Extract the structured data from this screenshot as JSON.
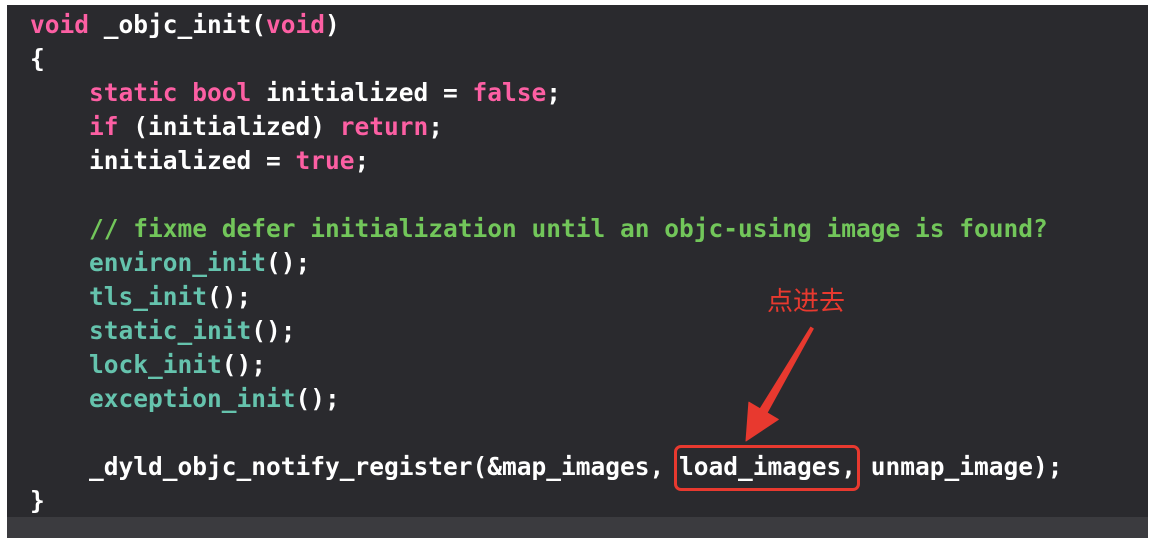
{
  "theme": {
    "page_background": "#ffffff",
    "editor_background": "#2a2a2e",
    "footer_strip": "#3b3b3f",
    "plain_text": "#ffffff",
    "keyword": "#fc5fa3",
    "comment": "#72c65a",
    "function": "#65c3ad",
    "annotation": "#e8392f"
  },
  "code": {
    "lines": [
      {
        "tokens": [
          {
            "kind": "keyword",
            "text": "void"
          },
          {
            "kind": "plain",
            "text": " _objc_init("
          },
          {
            "kind": "keyword",
            "text": "void"
          },
          {
            "kind": "plain",
            "text": ")"
          }
        ]
      },
      {
        "tokens": [
          {
            "kind": "plain",
            "text": "{"
          }
        ]
      },
      {
        "tokens": [
          {
            "kind": "keyword",
            "text": "static bool"
          },
          {
            "kind": "plain",
            "text": " initialized = "
          },
          {
            "kind": "keyword",
            "text": "false"
          },
          {
            "kind": "plain",
            "text": ";"
          }
        ]
      },
      {
        "tokens": [
          {
            "kind": "keyword",
            "text": "if"
          },
          {
            "kind": "plain",
            "text": " (initialized) "
          },
          {
            "kind": "keyword",
            "text": "return"
          },
          {
            "kind": "plain",
            "text": ";"
          }
        ]
      },
      {
        "tokens": [
          {
            "kind": "plain",
            "text": "initialized = "
          },
          {
            "kind": "keyword",
            "text": "true"
          },
          {
            "kind": "plain",
            "text": ";"
          }
        ]
      },
      {
        "tokens": []
      },
      {
        "tokens": [
          {
            "kind": "comment",
            "text": "// fixme defer initialization until an objc-using image is found?"
          }
        ]
      },
      {
        "tokens": [
          {
            "kind": "function",
            "text": "environ_init"
          },
          {
            "kind": "plain",
            "text": "();"
          }
        ]
      },
      {
        "tokens": [
          {
            "kind": "function",
            "text": "tls_init"
          },
          {
            "kind": "plain",
            "text": "();"
          }
        ]
      },
      {
        "tokens": [
          {
            "kind": "function",
            "text": "static_init"
          },
          {
            "kind": "plain",
            "text": "();"
          }
        ]
      },
      {
        "tokens": [
          {
            "kind": "function",
            "text": "lock_init"
          },
          {
            "kind": "plain",
            "text": "();"
          }
        ]
      },
      {
        "tokens": [
          {
            "kind": "function",
            "text": "exception_init"
          },
          {
            "kind": "plain",
            "text": "();"
          }
        ]
      },
      {
        "tokens": []
      },
      {
        "tokens": [
          {
            "kind": "plain",
            "text": "_dyld_objc_notify_register(&map_images, "
          },
          {
            "kind": "plain",
            "text": "load_images,"
          },
          {
            "kind": "plain",
            "text": " unmap_image);"
          }
        ]
      },
      {
        "tokens": [
          {
            "kind": "plain",
            "text": "}"
          }
        ]
      }
    ]
  },
  "annotation": {
    "label": "点进去"
  }
}
